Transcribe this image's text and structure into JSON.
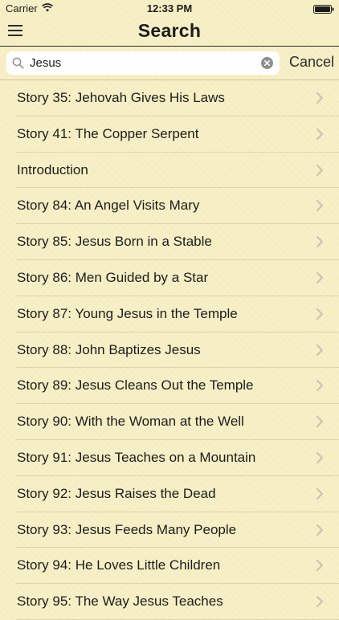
{
  "status_bar": {
    "carrier": "Carrier",
    "time": "12:33 PM",
    "wifi_icon": "wifi-icon",
    "battery_icon": "battery-icon"
  },
  "nav": {
    "title": "Search",
    "menu_icon": "hamburger-menu-icon"
  },
  "search": {
    "value": "Jesus",
    "search_icon": "magnifier-icon",
    "clear_icon": "clear-circle-icon",
    "cancel_label": "Cancel"
  },
  "results": [
    {
      "label": "Story 35: Jehovah Gives His Laws"
    },
    {
      "label": "Story 41: The Copper Serpent"
    },
    {
      "label": "Introduction"
    },
    {
      "label": "Story 84: An Angel Visits Mary"
    },
    {
      "label": "Story 85: Jesus Born in a Stable"
    },
    {
      "label": "Story 86: Men Guided by a Star"
    },
    {
      "label": "Story 87: Young Jesus in the Temple"
    },
    {
      "label": "Story 88: John Baptizes Jesus"
    },
    {
      "label": "Story 89: Jesus Cleans Out the Temple"
    },
    {
      "label": "Story 90: With the Woman at the Well"
    },
    {
      "label": "Story 91: Jesus Teaches on a Mountain"
    },
    {
      "label": "Story 92: Jesus Raises the Dead"
    },
    {
      "label": "Story 93: Jesus Feeds Many People"
    },
    {
      "label": "Story 94: He Loves Little Children"
    },
    {
      "label": "Story 95: The Way Jesus Teaches"
    }
  ],
  "colors": {
    "background": "#f7f0c6",
    "text": "#1c1c1c",
    "chevron": "#c7c2ae",
    "separator": "#ddd3a9"
  }
}
